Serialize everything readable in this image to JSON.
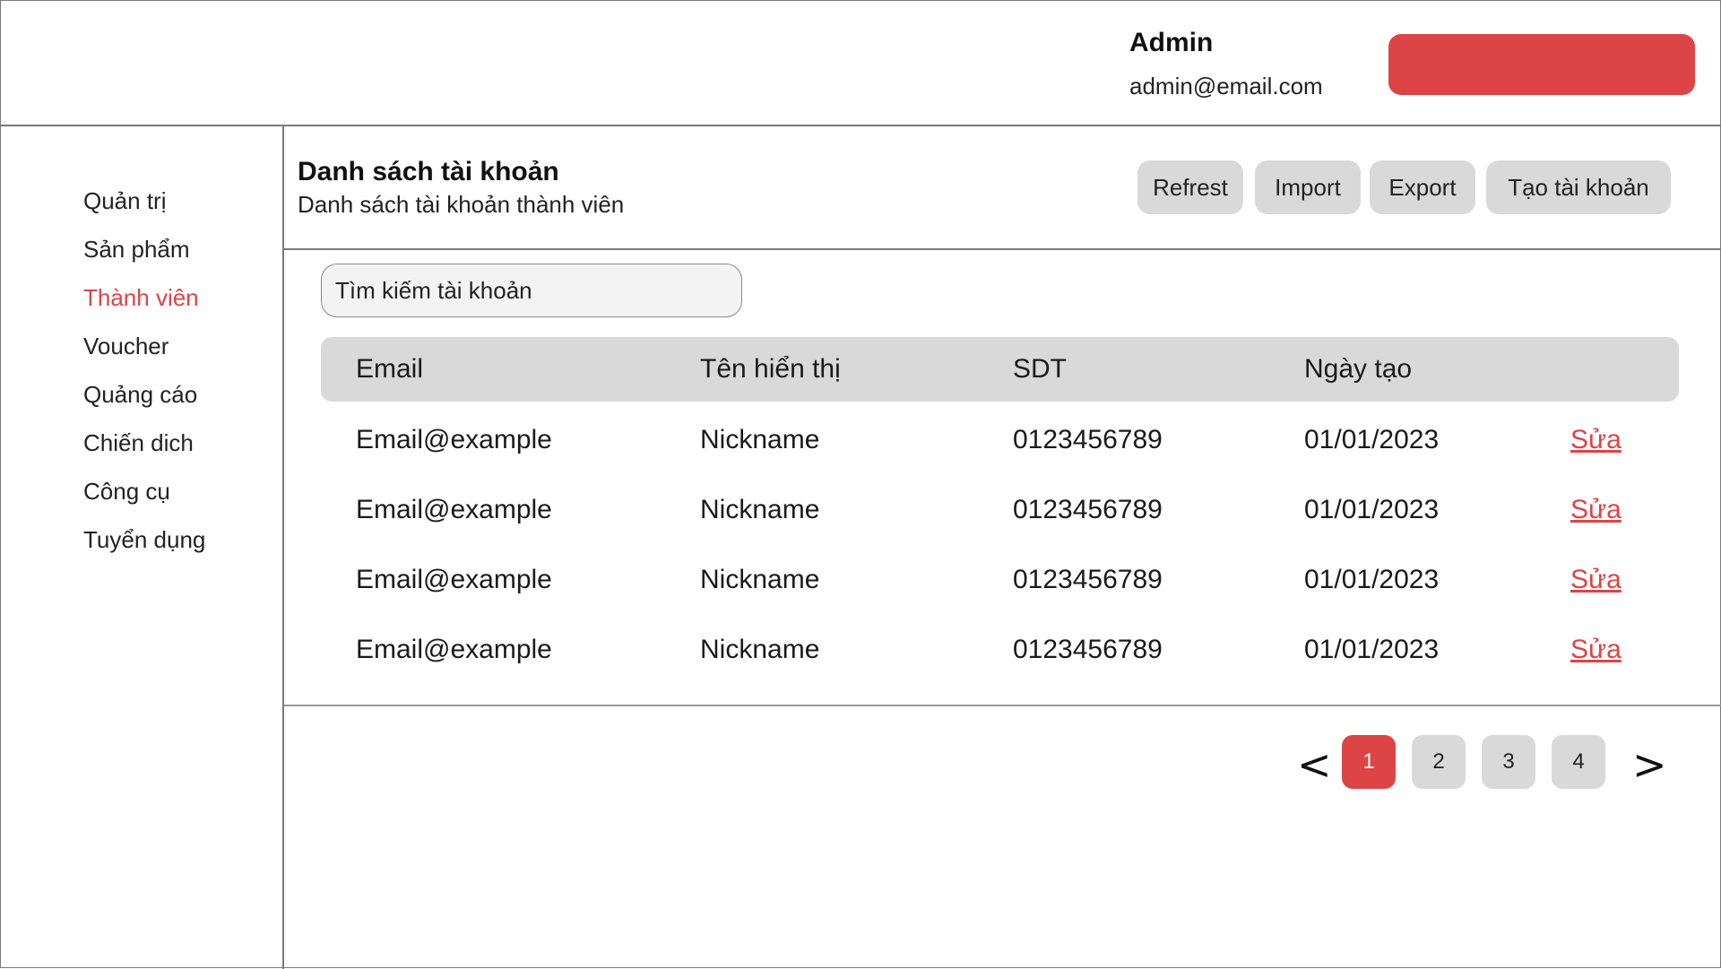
{
  "header": {
    "user_name": "Admin",
    "user_email": "admin@email.com",
    "action_button_label": ""
  },
  "sidebar": {
    "items": [
      {
        "label": "Quản trị",
        "active": false
      },
      {
        "label": "Sản phẩm",
        "active": false
      },
      {
        "label": "Thành viên",
        "active": true
      },
      {
        "label": "Voucher",
        "active": false
      },
      {
        "label": "Quảng cáo",
        "active": false
      },
      {
        "label": "Chiến dich",
        "active": false
      },
      {
        "label": "Công cụ",
        "active": false
      },
      {
        "label": "Tuyển dụng",
        "active": false
      }
    ]
  },
  "page": {
    "title": "Danh sách tài khoản",
    "subtitle": "Danh sách tài khoản thành viên"
  },
  "toolbar": {
    "refresh_label": "Refrest",
    "import_label": "Import",
    "export_label": "Export",
    "create_label": "Tạo tài khoản"
  },
  "search": {
    "placeholder": "Tìm kiếm tài khoản",
    "value": ""
  },
  "table": {
    "columns": [
      "Email",
      "Tên hiển thị",
      "SDT",
      "Ngày tạo"
    ],
    "rows": [
      {
        "email": "Email@example",
        "nickname": "Nickname",
        "phone": "0123456789",
        "date": "01/01/2023",
        "action": "Sửa"
      },
      {
        "email": "Email@example",
        "nickname": "Nickname",
        "phone": "0123456789",
        "date": "01/01/2023",
        "action": "Sửa"
      },
      {
        "email": "Email@example",
        "nickname": "Nickname",
        "phone": "0123456789",
        "date": "01/01/2023",
        "action": "Sửa"
      },
      {
        "email": "Email@example",
        "nickname": "Nickname",
        "phone": "0123456789",
        "date": "01/01/2023",
        "action": "Sửa"
      }
    ]
  },
  "pagination": {
    "prev_label": "<",
    "next_label": ">",
    "pages": [
      "1",
      "2",
      "3",
      "4"
    ],
    "current_page": "1"
  },
  "colors": {
    "accent": "#dc4446",
    "button_gray": "#d9d9d9",
    "border": "#7a7a7a"
  }
}
